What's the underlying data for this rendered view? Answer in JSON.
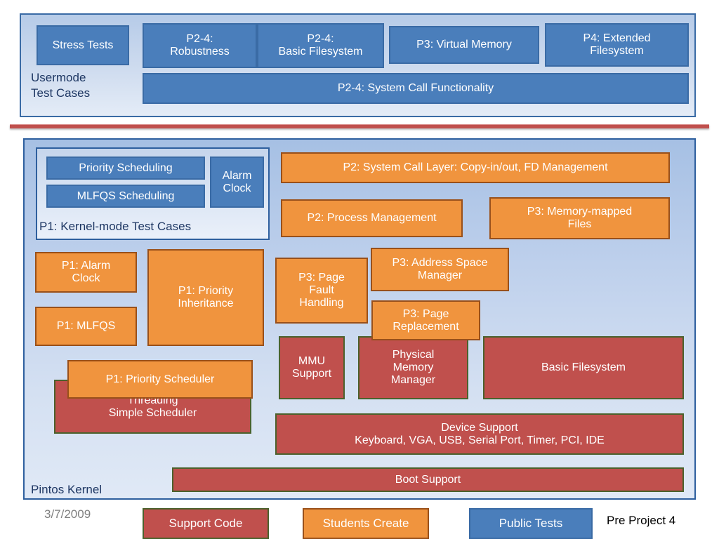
{
  "usermode_section": {
    "panel_label": "Usermode\nTest Cases",
    "boxes": [
      {
        "label": "Stress Tests",
        "kind": "blue"
      },
      {
        "label": "P2-4:\nRobustness",
        "kind": "blue"
      },
      {
        "label": "P2-4:\nBasic Filesystem",
        "kind": "blue"
      },
      {
        "label": "P3: Virtual Memory",
        "kind": "blue"
      },
      {
        "label": "P4: Extended\nFilesystem",
        "kind": "blue"
      },
      {
        "label": "P2-4: System Call Functionality",
        "kind": "blue"
      }
    ]
  },
  "kernel_section": {
    "panel_label": "Pintos Kernel",
    "test_panel_label": "P1: Kernel-mode Test Cases",
    "test_boxes": [
      {
        "label": "Priority Scheduling",
        "kind": "blue"
      },
      {
        "label": "MLFQS Scheduling",
        "kind": "blue"
      },
      {
        "label": "Alarm\nClock",
        "kind": "blue"
      }
    ],
    "orange_boxes": [
      {
        "label": "P2: System Call Layer: Copy-in/out, FD Management"
      },
      {
        "label": "P2: Process Management"
      },
      {
        "label": "P3: Memory-mapped\nFiles"
      },
      {
        "label": "P1: Alarm\nClock"
      },
      {
        "label": "P1: MLFQS"
      },
      {
        "label": "P1: Priority\nInheritance"
      },
      {
        "label": "P3: Page\nFault\nHandling"
      },
      {
        "label": "P3: Address Space\nManager"
      },
      {
        "label": "P3: Page\nReplacement"
      },
      {
        "label": "P1: Priority Scheduler"
      }
    ],
    "red_boxes": [
      {
        "label": "MMU\nSupport"
      },
      {
        "label": "Physical\nMemory\nManager"
      },
      {
        "label": "Basic Filesystem"
      },
      {
        "label": "Threading\nSimple Scheduler"
      },
      {
        "label": "Device Support\nKeyboard, VGA, USB, Serial Port, Timer, PCI, IDE"
      },
      {
        "label": "Boot Support"
      }
    ]
  },
  "footer": {
    "date": "3/7/2009",
    "note": "Pre Project 4",
    "legend": [
      {
        "label": "Support Code",
        "kind": "red"
      },
      {
        "label": "Students Create",
        "kind": "orange"
      },
      {
        "label": "Public Tests",
        "kind": "blue"
      }
    ]
  },
  "colors": {
    "blue_fill": "#4a7ebb",
    "blue_border": "#3a6ba5",
    "orange_fill": "#f0943e",
    "orange_border": "#99501a",
    "red_fill": "#c0504d",
    "red_border": "#4b612c",
    "panel_border": "#2e5f9e",
    "dark_text": "#1f3864",
    "separator": "#c0504d"
  }
}
